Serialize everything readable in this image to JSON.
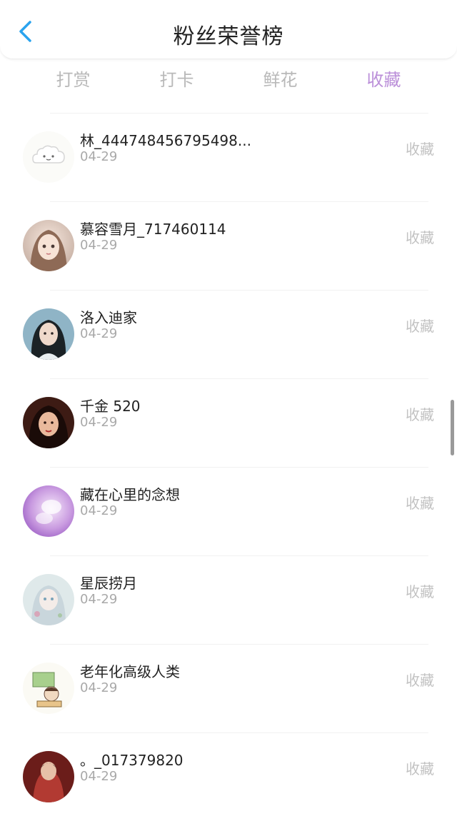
{
  "header": {
    "title": "粉丝荣誉榜"
  },
  "tabs": [
    {
      "label": "打赏"
    },
    {
      "label": "打卡"
    },
    {
      "label": "鲜花"
    },
    {
      "label": "收藏"
    }
  ],
  "fans": [
    {
      "name": "林_444748456795498...",
      "date": "04-29",
      "action": "收藏"
    },
    {
      "name": "慕容雪月_717460114",
      "date": "04-29",
      "action": "收藏"
    },
    {
      "name": "洛入迪家",
      "date": "04-29",
      "action": "收藏"
    },
    {
      "name": "千金 520",
      "date": "04-29",
      "action": "收藏"
    },
    {
      "name": "藏在心里的念想",
      "date": "04-29",
      "action": "收藏"
    },
    {
      "name": "星辰捞月",
      "date": "04-29",
      "action": "收藏"
    },
    {
      "name": "老年化高级人类",
      "date": "04-29",
      "action": "收藏"
    },
    {
      "name": "。_017379820",
      "date": "04-29",
      "action": "收藏"
    }
  ],
  "colors": {
    "active_tab": "#bb8fd9",
    "inactive_tab": "#b9b9b9",
    "back_arrow": "#2aa3ee"
  },
  "icons": {
    "back": "chevron-left-icon"
  }
}
